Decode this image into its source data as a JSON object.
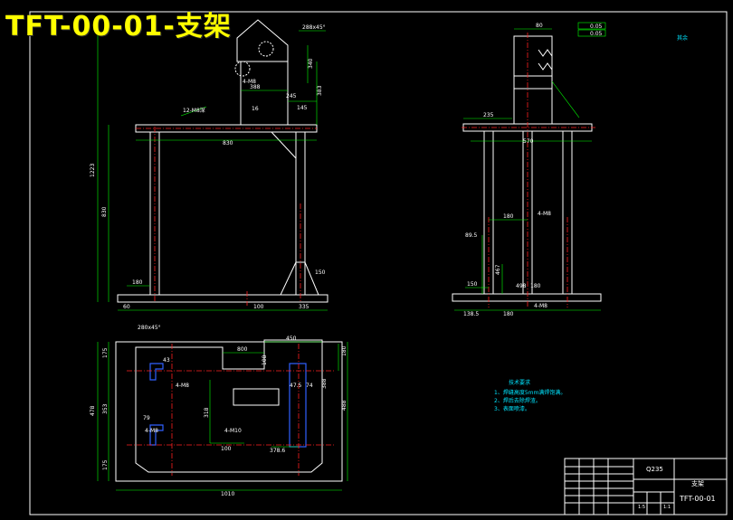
{
  "drawing_title": "TFT-00-01-支架",
  "front_view": {
    "dims": {
      "top_width": "830",
      "overall_height": "1223",
      "frame_height": "830",
      "base_left_offset": "180",
      "base_foot": "60",
      "base_mid": "100",
      "base_right": "335",
      "gusset": "150",
      "plate_width": "245",
      "plate_offset": "145",
      "plate_small": "16",
      "plate_base": "388",
      "plate_height": "383",
      "chamfer": "288x45°",
      "plate_side": "340",
      "hole_note": "4-M8",
      "thread_note": "12-M8深"
    }
  },
  "side_view": {
    "dims": {
      "top_ext": "235",
      "inner_width": "570",
      "width": "498",
      "col_gap": "180",
      "height_left": "89.5",
      "height_mid": "467",
      "base_gap": "180",
      "base_left": "150",
      "base_bottom_left": "138.5",
      "base_bottom_mid": "180",
      "hole_note": "4-M8",
      "bottom_hole_note": "4-M8",
      "tol_1": "0.05",
      "tol_2": "0.05",
      "top_dim": "80"
    }
  },
  "top_view": {
    "dims": {
      "chamfer": "280x45°",
      "overall_width": "1010",
      "overall_height": "478",
      "right_height": "488",
      "left_top": "175",
      "left_mid": "353",
      "left_bottom": "175",
      "inner_w1": "800",
      "inner_w2": "450",
      "dim_43": "43",
      "dim_79": "79",
      "dim_47": "47.5",
      "dim_74": "74",
      "dim_378": "378.6",
      "dim_108": "108",
      "dim_100": "100",
      "dim_318": "318",
      "dim_388": "388",
      "right_small": "180",
      "hole_note": "4-M8",
      "hole_note2": "4-M10",
      "hole_note3": "4-M8"
    }
  },
  "tech_notes": {
    "title": "技术要求",
    "items": [
      "1、焊缝高度5mm满焊饱满。",
      "2、焊后去除焊渣。",
      "3、表面喷漆。"
    ]
  },
  "title_block": {
    "material": "Q235",
    "part_name": "支架",
    "part_no": "TFT-00-01",
    "scale_1": "1:5",
    "scale_2": "1:1"
  },
  "corner_mark": "其余"
}
